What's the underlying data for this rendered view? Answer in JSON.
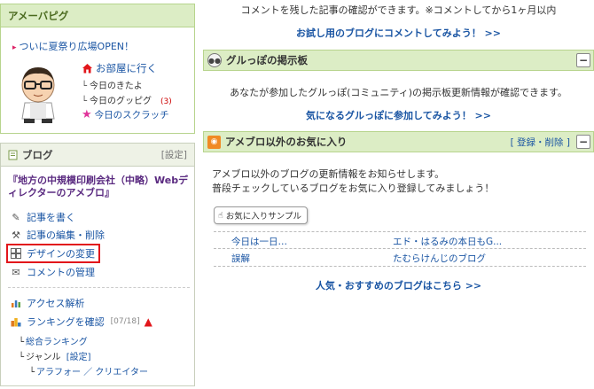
{
  "ameba": {
    "title": "アメーバピグ",
    "promo": "ついに夏祭り広場OPEN！",
    "home_link": "お部屋に行く",
    "items": [
      {
        "label": "今日のきたよ",
        "count": ""
      },
      {
        "label": "今日のグッピグ",
        "count": "(3)"
      }
    ],
    "scratch": "今日のスクラッチ"
  },
  "blog": {
    "title": "ブログ",
    "settings": "[設定]",
    "blog_name": "『地方の中規模印刷会社（中略）Webディレクターのアメブロ』",
    "menu": {
      "write": "記事を書く",
      "edit": "記事の編集・削除",
      "design": "デザインの変更",
      "comments": "コメントの管理",
      "access": "アクセス解析",
      "ranking": "ランキングを確認",
      "ranking_date": "[07/18]"
    },
    "ranking_sub": {
      "overall": "総合ランキング",
      "genre": "ジャンル",
      "genre_settings": "[設定]",
      "category": "アラフォー ／ クリエイター"
    }
  },
  "comments": {
    "desc": "コメントを残した記事の確認ができます。※コメントしてから1ヶ月以内",
    "cta": "お試し用のブログにコメントしてみよう！ >>"
  },
  "gurubo": {
    "title": "グルっぽの掲示板",
    "desc": "あなたが参加したグルっぽ(コミュニティ)の掲示板更新情報が確認できます。",
    "cta": "気になるグルっぽに参加してみよう！ >>"
  },
  "favorites": {
    "title": "アメブロ以外のお気に入り",
    "register_delete": "[ 登録・削除 ]",
    "desc_line1": "アメブロ以外のブログの更新情報をお知らせします。",
    "desc_line2": "普段チェックしているブログをお気に入り登録してみましょう！",
    "tooltip": "お気に入りサンプル",
    "rows": [
      {
        "left": "今日は一日…",
        "right": "エド・はるみの本日もG..."
      },
      {
        "left": "誤解",
        "right": "たむらけんじのブログ"
      }
    ],
    "cta": "人気・おすすめのブログはこちら >>"
  },
  "colors": {
    "link": "#1a55a3",
    "panel_header": "#dcedc5",
    "highlight": "#e2161b"
  }
}
